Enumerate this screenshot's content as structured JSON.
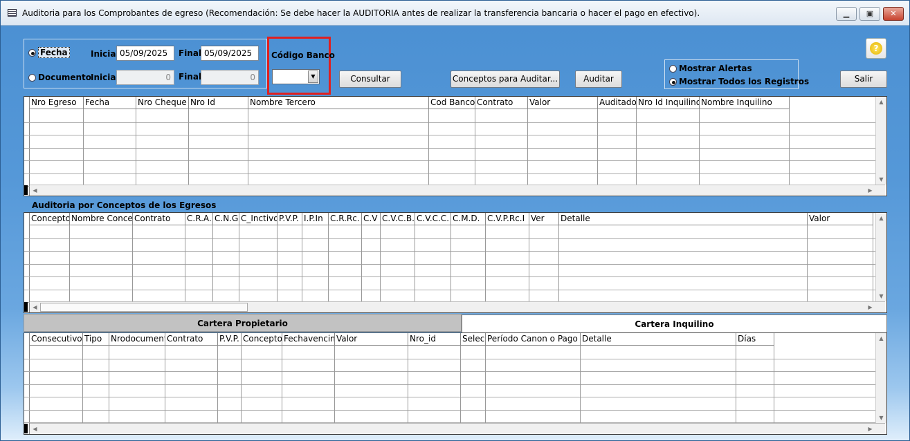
{
  "window": {
    "title": "Auditoria para los Comprobantes de egreso (Recomendación: Se debe hacer la AUDITORIA antes de realizar la transferencia bancaria o hacer el pago en efectivo)."
  },
  "filters": {
    "fecha_label": "Fecha",
    "documento_label": "Documento",
    "inicial_label": "Inicial",
    "final_label": "Final",
    "fecha_inicial": "05/09/2025",
    "fecha_final": "05/09/2025",
    "doc_inicial": "0",
    "doc_final": "0",
    "codigo_banco_label": "Código Banco",
    "codigo_banco_value": ""
  },
  "buttons": {
    "consultar": "Consultar",
    "conceptos": "Conceptos para Auditar...",
    "auditar": "Auditar",
    "salir": "Salir"
  },
  "options": {
    "mostrar_alertas": "Mostrar Alertas",
    "mostrar_todos": "Mostrar Todos los Registros"
  },
  "grid1": {
    "columns": [
      "Nro Egreso",
      "Fecha",
      "Nro Cheque",
      "Nro Id",
      "Nombre Tercero",
      "Cod Banco",
      "Contrato",
      "Valor",
      "Auditado",
      "Nro Id Inquilino",
      "Nombre Inquilino"
    ]
  },
  "section2": {
    "title": "Auditoria por Conceptos de los Egresos"
  },
  "grid2": {
    "columns": [
      "Concepto",
      "Nombre Concep",
      "Contrato",
      "C.R.A.",
      "C.N.G",
      "C_Inctivo",
      "P.V.P.",
      "I.P.In",
      "C.R.Rc.",
      "C.V",
      "C.V.C.B.",
      "C.V.C.C.",
      "C.M.D.",
      "C.V.P.Rc.I",
      "Ver",
      "Detalle",
      "Valor"
    ]
  },
  "tabs": {
    "propietario": "Cartera Propietario",
    "inquilino": "Cartera Inquilino"
  },
  "grid3": {
    "columns": [
      "Consecutivo",
      "Tipo",
      "Nrodocumento",
      "Contrato",
      "P.V.P.",
      "Concepto",
      "Fechavencim",
      "Valor",
      "Nro_id",
      "Selec",
      "Período Canon o Pago",
      "Detalle",
      "Días"
    ]
  }
}
